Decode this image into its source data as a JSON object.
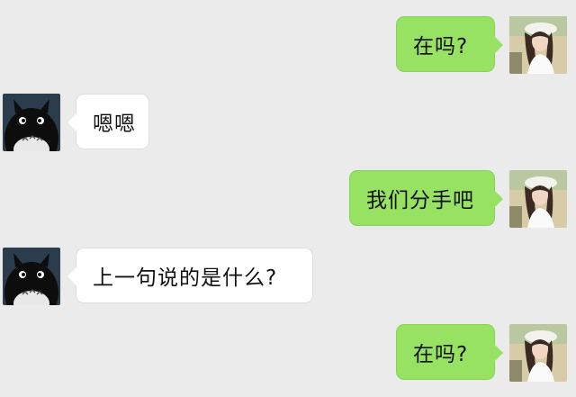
{
  "conversation": {
    "messages": [
      {
        "sender": "me",
        "avatar_icon": "girl-avatar-icon",
        "text": "在吗?"
      },
      {
        "sender": "other",
        "avatar_icon": "totoro-avatar-icon",
        "text": "嗯嗯"
      },
      {
        "sender": "me",
        "avatar_icon": "girl-avatar-icon",
        "text": "我们分手吧"
      },
      {
        "sender": "other",
        "avatar_icon": "totoro-avatar-icon",
        "text": "上一句说的是什么?"
      },
      {
        "sender": "me",
        "avatar_icon": "girl-avatar-icon",
        "text": "在吗?"
      }
    ]
  },
  "colors": {
    "background": "#ebebeb",
    "outgoing_bubble": "#97e163",
    "incoming_bubble": "#ffffff",
    "text": "#111111"
  }
}
